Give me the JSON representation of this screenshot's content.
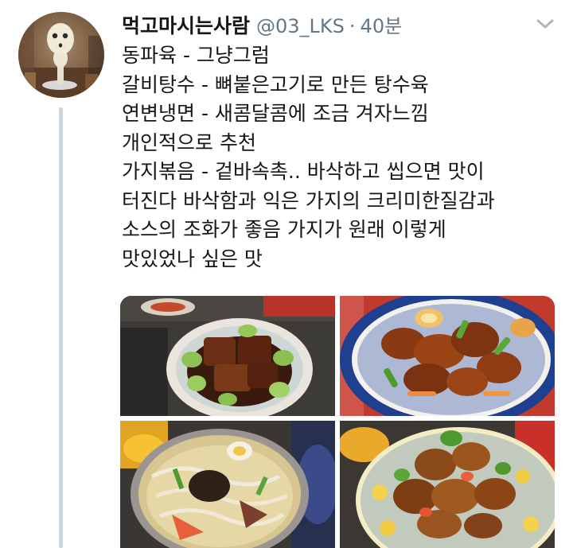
{
  "tweet": {
    "display_name": "먹고마시는사람",
    "handle": "@03_LKS",
    "separator": "·",
    "timestamp": "40분",
    "text_lines": [
      "동파육 - 그냥그럼",
      "갈비탕수 - 뼈붙은고기로 만든 탕수육",
      "연변냉면 - 새콤달콤에 조금 겨자느낌",
      "개인적으로 추천",
      "가지볶음 - 겉바속촉.. 바삭하고 씹으면 맛이",
      "터진다 바삭함과 익은 가지의 크리미한질감과",
      "소스의 조화가 좋음 가지가 원래 이렇게",
      "맛있었나 싶은 맛"
    ]
  },
  "icons": {
    "avatar": "kodama-figure-avatar",
    "more": "chevron-down-icon"
  },
  "colors": {
    "secondary_text": "#657786",
    "primary_text": "#14171a",
    "thread_line": "#ccd6dd"
  }
}
